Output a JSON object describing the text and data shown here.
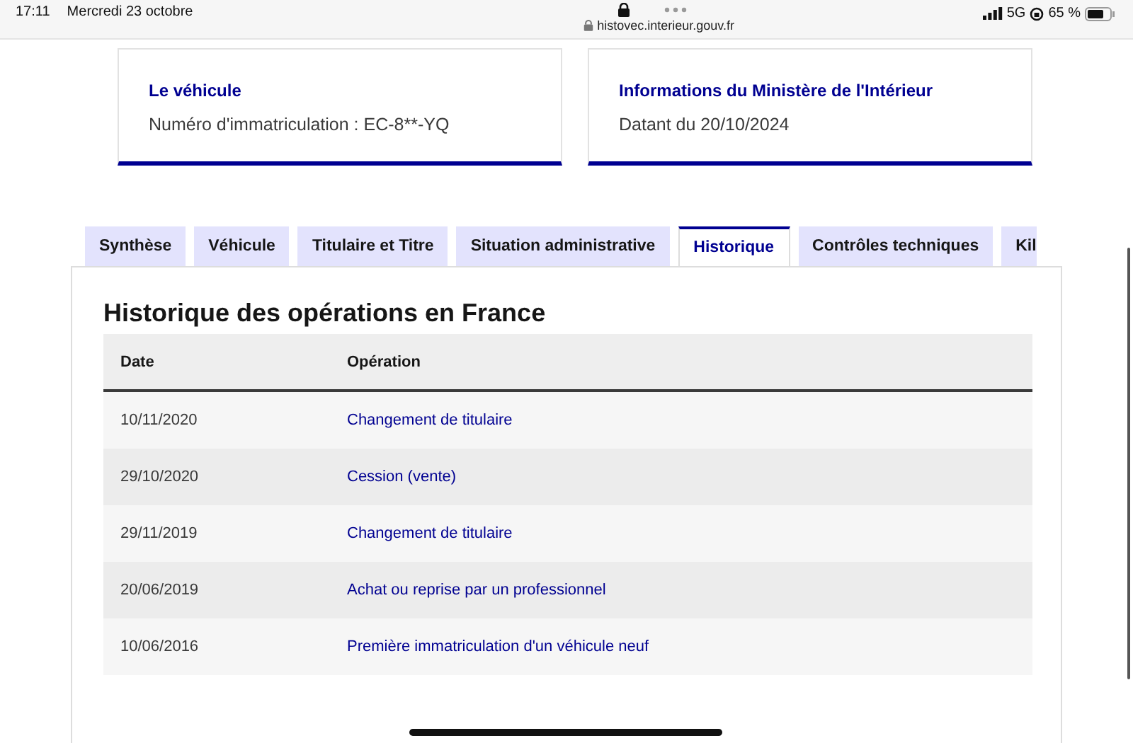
{
  "status_bar": {
    "time": "17:11",
    "date": "Mercredi 23 octobre",
    "url": "histovec.interieur.gouv.fr",
    "network": "5G",
    "battery": "65 %"
  },
  "cards": [
    {
      "title": "Le véhicule",
      "text": "Numéro d'immatriculation : EC-8**-YQ"
    },
    {
      "title": "Informations du Ministère de l'Intérieur",
      "text": "Datant du 20/10/2024"
    }
  ],
  "tabs": [
    {
      "label": "Synthèse",
      "selected": false
    },
    {
      "label": "Véhicule",
      "selected": false
    },
    {
      "label": "Titulaire et Titre",
      "selected": false
    },
    {
      "label": "Situation administrative",
      "selected": false
    },
    {
      "label": "Historique",
      "selected": true
    },
    {
      "label": "Contrôles techniques",
      "selected": false
    },
    {
      "label": "Kil",
      "selected": false
    }
  ],
  "section": {
    "title": "Historique des opérations en France",
    "table": {
      "columns": [
        "Date",
        "Opération"
      ],
      "rows": [
        [
          "10/11/2020",
          "Changement de titulaire"
        ],
        [
          "29/10/2020",
          "Cession (vente)"
        ],
        [
          "29/11/2019",
          "Changement de titulaire"
        ],
        [
          "20/06/2019",
          "Achat ou reprise par un professionnel"
        ],
        [
          "10/06/2016",
          "Première immatriculation d'un véhicule neuf"
        ]
      ]
    }
  }
}
